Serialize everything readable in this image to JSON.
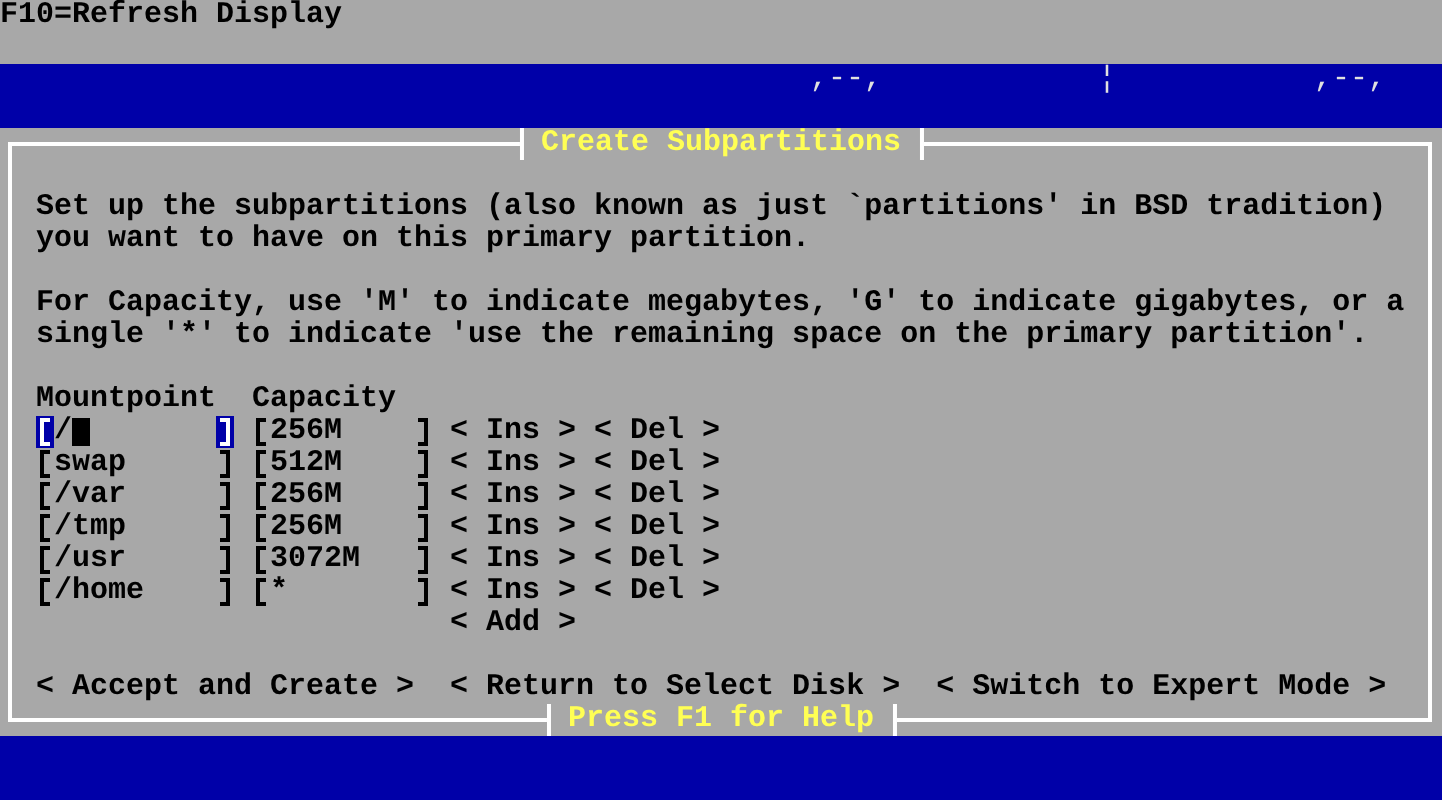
{
  "top_hint": "F10=Refresh Display",
  "background_fragments": [
    ",--,",
    "¦",
    ",--,"
  ],
  "dialog": {
    "title": "Create Subpartitions",
    "paragraphs": [
      "Set up the subpartitions (also known as just `partitions' in BSD tradition) you want to have on this primary partition.",
      "For Capacity, use 'M' to indicate megabytes, 'G' to indicate gigabytes, or a single '*' to indicate 'use the remaining space on the primary partition'."
    ],
    "columns": [
      "Mountpoint",
      "Capacity"
    ],
    "entries": [
      {
        "mountpoint": "/",
        "capacity": "256M",
        "focused": true,
        "insert": "< Ins >",
        "delete": "< Del >"
      },
      {
        "mountpoint": "swap",
        "capacity": "512M",
        "focused": false,
        "insert": "< Ins >",
        "delete": "< Del >"
      },
      {
        "mountpoint": "/var",
        "capacity": "256M",
        "focused": false,
        "insert": "< Ins >",
        "delete": "< Del >"
      },
      {
        "mountpoint": "/tmp",
        "capacity": "256M",
        "focused": false,
        "insert": "< Ins >",
        "delete": "< Del >"
      },
      {
        "mountpoint": "/usr",
        "capacity": "3072M",
        "focused": false,
        "insert": "< Ins >",
        "delete": "< Del >"
      },
      {
        "mountpoint": "/home",
        "capacity": "*",
        "focused": false,
        "insert": "< Ins >",
        "delete": "< Del >"
      }
    ],
    "add_button": "< Add >",
    "buttons": [
      "< Accept and Create >",
      "< Return to Select Disk >",
      "< Switch to Expert Mode >"
    ],
    "help": "Press F1 for Help"
  }
}
